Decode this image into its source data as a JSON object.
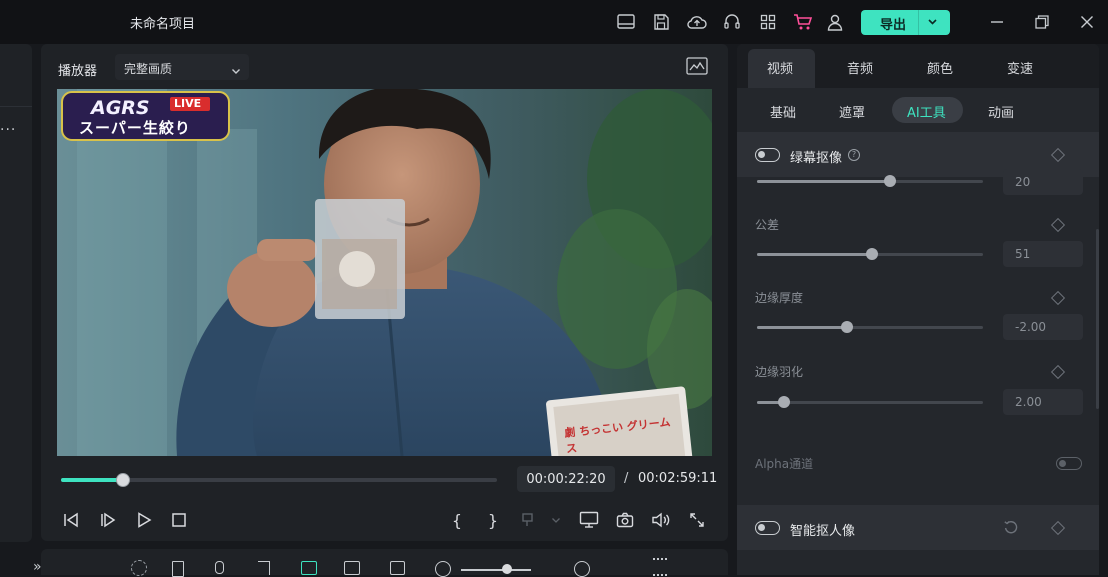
{
  "app": {
    "title": "未命名项目",
    "export_label": "导出"
  },
  "colors": {
    "accent": "#3ee3c0",
    "background": "#17191d",
    "panel": "#1f2226",
    "live_badge": "#d92d2d"
  },
  "player": {
    "label": "播放器",
    "quality": "完整画质",
    "progress_fraction": 0.14,
    "time_current": "00:00:22:20",
    "time_separator": "/",
    "time_total": "00:02:59:11",
    "overlay_logo_text": "AGRS",
    "overlay_live": "LIVE",
    "overlay_subtitle": "スーパー生絞り",
    "package_text": "劇 ちっこい グリームス"
  },
  "inspector": {
    "tabs": [
      {
        "label": "视频"
      },
      {
        "label": "音频"
      },
      {
        "label": "颜色"
      },
      {
        "label": "变速"
      }
    ],
    "active_tab": "视频",
    "subtabs": [
      {
        "label": "基础"
      },
      {
        "label": "遮罩"
      },
      {
        "label": "AI工具"
      },
      {
        "label": "动画"
      }
    ],
    "active_subtab": "AI工具",
    "chroma": {
      "title": "绿幕抠像",
      "enabled": false,
      "params": [
        {
          "label": "",
          "value": "20",
          "fraction": 0.59
        },
        {
          "label": "公差",
          "value": "51",
          "fraction": 0.51
        },
        {
          "label": "边缘厚度",
          "value": "-2.00",
          "fraction": 0.4
        },
        {
          "label": "边缘羽化",
          "value": "2.00",
          "fraction": 0.12
        }
      ],
      "alpha_label": "Alpha通道",
      "alpha_enabled": false
    },
    "smart_cutout": {
      "title": "智能抠人像",
      "enabled": false
    }
  }
}
